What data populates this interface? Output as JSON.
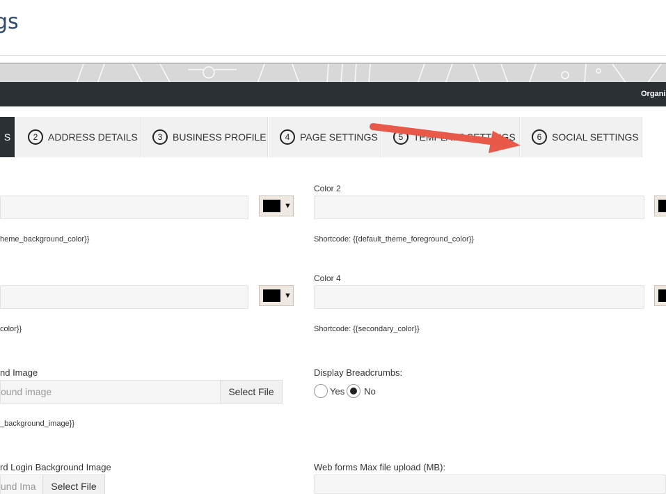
{
  "header": {
    "title": "gs"
  },
  "topbar": {
    "org_label": "Organiz"
  },
  "tabs": [
    {
      "num": "",
      "label": "S"
    },
    {
      "num": "2",
      "label": "ADDRESS DETAILS"
    },
    {
      "num": "3",
      "label": "BUSINESS PROFILE"
    },
    {
      "num": "4",
      "label": "PAGE SETTINGS"
    },
    {
      "num": "5",
      "label": "TEMPLATE SETTINGS"
    },
    {
      "num": "6",
      "label": "SOCIAL SETTINGS"
    }
  ],
  "form": {
    "color1": {
      "shortcode": "heme_background_color}}"
    },
    "color2": {
      "label": "Color 2",
      "shortcode": "Shortcode: {{default_theme_foreground_color}}"
    },
    "color3": {
      "shortcode": "color}}"
    },
    "color4": {
      "label": "Color 4",
      "shortcode": "Shortcode: {{secondary_color}}"
    },
    "bg_image": {
      "label": "nd Image",
      "placeholder": "ound image",
      "button": "Select File",
      "shortcode": "_background_image}}"
    },
    "breadcrumbs": {
      "label": "Display Breadcrumbs:",
      "yes": "Yes",
      "no": "No",
      "selected": "No"
    },
    "login_bg": {
      "label": "rd Login Background Image",
      "placeholder": "und Ima",
      "button": "Select File"
    },
    "max_upload": {
      "label": "Web forms Max file upload (MB):"
    }
  },
  "colors": {
    "swatch": "#000000",
    "topbar": "#2b3034",
    "arrow": "#e8594a"
  }
}
